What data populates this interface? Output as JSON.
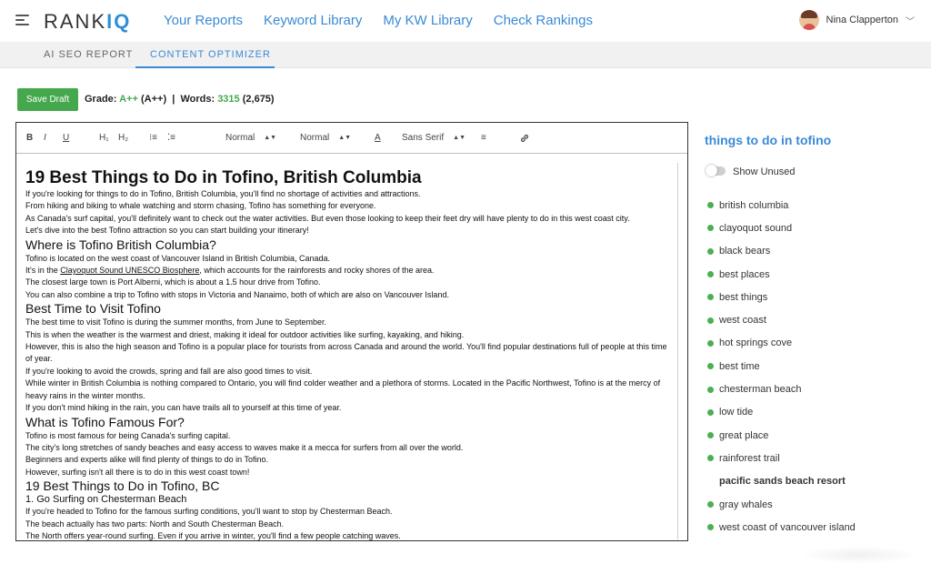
{
  "app": {
    "logo_text": "RANK",
    "logo_accent": "IQ"
  },
  "nav": [
    "Your Reports",
    "Keyword Library",
    "My KW Library",
    "Check Rankings"
  ],
  "user": {
    "name": "Nina Clapperton"
  },
  "subtabs": [
    "AI SEO REPORT",
    "CONTENT OPTIMIZER"
  ],
  "active_subtab": "CONTENT OPTIMIZER",
  "toolbar": {
    "save_label": "Save Draft",
    "grade_label": "Grade:",
    "grade_value": "A++",
    "grade_target": "(A++)",
    "sep": "|",
    "words_label": "Words:",
    "words_value": "3315",
    "words_target": "(2,675)"
  },
  "editor_toolbar": {
    "bold": "B",
    "italic": "I",
    "underline": "U",
    "h1": "H₁",
    "h2": "H₂",
    "ordered_list": "⁝≡",
    "bullet_list": "⁚≡",
    "size_1": "Normal",
    "size_2": "Normal",
    "color": "A",
    "font": "Sans Serif",
    "align": "≡",
    "link": "🔗"
  },
  "document": {
    "h1": "19 Best Things to Do in Tofino, British Columbia",
    "p1": "If you're looking for things to do in Tofino, British Columbia, you'll find no shortage of activities and attractions.",
    "p2": "From hiking and biking to whale watching and storm chasing, Tofino has something for everyone.",
    "p3": "As Canada's surf capital, you'll definitely want to check out the water activities. But even those looking to keep their feet dry will have plenty to do in this west coast city.",
    "p4": "Let's dive into the best Tofino attraction so you can start building your itinerary!",
    "h2a": "Where is Tofino British Columbia?",
    "p5": "Tofino is located on the west coast of Vancouver Island in British Columbia, Canada.",
    "p6_pre": "It's in the ",
    "p6_link": "Clayoquot Sound UNESCO Biosphere",
    "p6_post": ", which accounts for the rainforests and rocky shores of the area.",
    "p7": "The closest large town is Port Alberni, which is about a 1.5 hour drive from Tofino.",
    "p8": "You can also combine a trip to Tofino with stops in Victoria and Nanaimo, both of which are also on Vancouver Island.",
    "h2b": "Best Time to Visit Tofino",
    "p9": "The best time to visit Tofino is during the summer months, from June to September.",
    "p10": "This is when the weather is the warmest and driest, making it ideal for outdoor activities like surfing, kayaking, and hiking.",
    "p11": "However, this is also the high season and Tofino is a popular place for tourists from across Canada and around the world. You'll find popular destinations full of people at this time of year.",
    "p12": "If you're looking to avoid the crowds, spring and fall are also good times to visit.",
    "p13": "While winter in British Columbia is nothing compared to Ontario, you will find colder weather and a plethora of storms. Located in the Pacific Northwest, Tofino is at the mercy of heavy rains in the winter months.",
    "p14": "If you don't mind hiking in the rain, you can have trails all to yourself at this time of year.",
    "h2c": "What is Tofino Famous For?",
    "p15": "Tofino is most famous for being Canada's surfing capital.",
    "p16": "The city's long stretches of sandy beaches and easy access to waves make it a mecca for surfers from all over the world.",
    "p17": "Beginners and experts alike will find plenty of things to do in Tofino.",
    "p18": "However, surfing isn't all there is to do in this west coast town!",
    "h2d": "19 Best Things to Do in Tofino, BC",
    "h3a": "1. Go Surfing on Chesterman Beach",
    "p19": "If you're headed to Tofino for the famous surfing conditions, you'll want to stop by Chesterman Beach.",
    "p20": "The beach actually has two parts: North and South Chesterman Beach.",
    "p21": "The North offers year-round surfing. Even if you arrive in winter, you'll find a few people catching waves."
  },
  "keywords": {
    "title": "things to do in tofino",
    "show_unused_label": "Show Unused",
    "items": [
      {
        "label": "british columbia",
        "used": true
      },
      {
        "label": "clayoquot sound",
        "used": true
      },
      {
        "label": "black bears",
        "used": true
      },
      {
        "label": "best places",
        "used": true
      },
      {
        "label": "best things",
        "used": true
      },
      {
        "label": "west coast",
        "used": true
      },
      {
        "label": "hot springs cove",
        "used": true
      },
      {
        "label": "best time",
        "used": true
      },
      {
        "label": "chesterman beach",
        "used": true
      },
      {
        "label": "low tide",
        "used": true
      },
      {
        "label": "great place",
        "used": true
      },
      {
        "label": "rainforest trail",
        "used": true
      },
      {
        "label": "pacific sands beach resort",
        "used": false
      },
      {
        "label": "gray whales",
        "used": true
      },
      {
        "label": "west coast of vancouver island",
        "used": true
      }
    ]
  },
  "colors": {
    "accent": "#3a8ad6",
    "success": "#45a84d"
  }
}
